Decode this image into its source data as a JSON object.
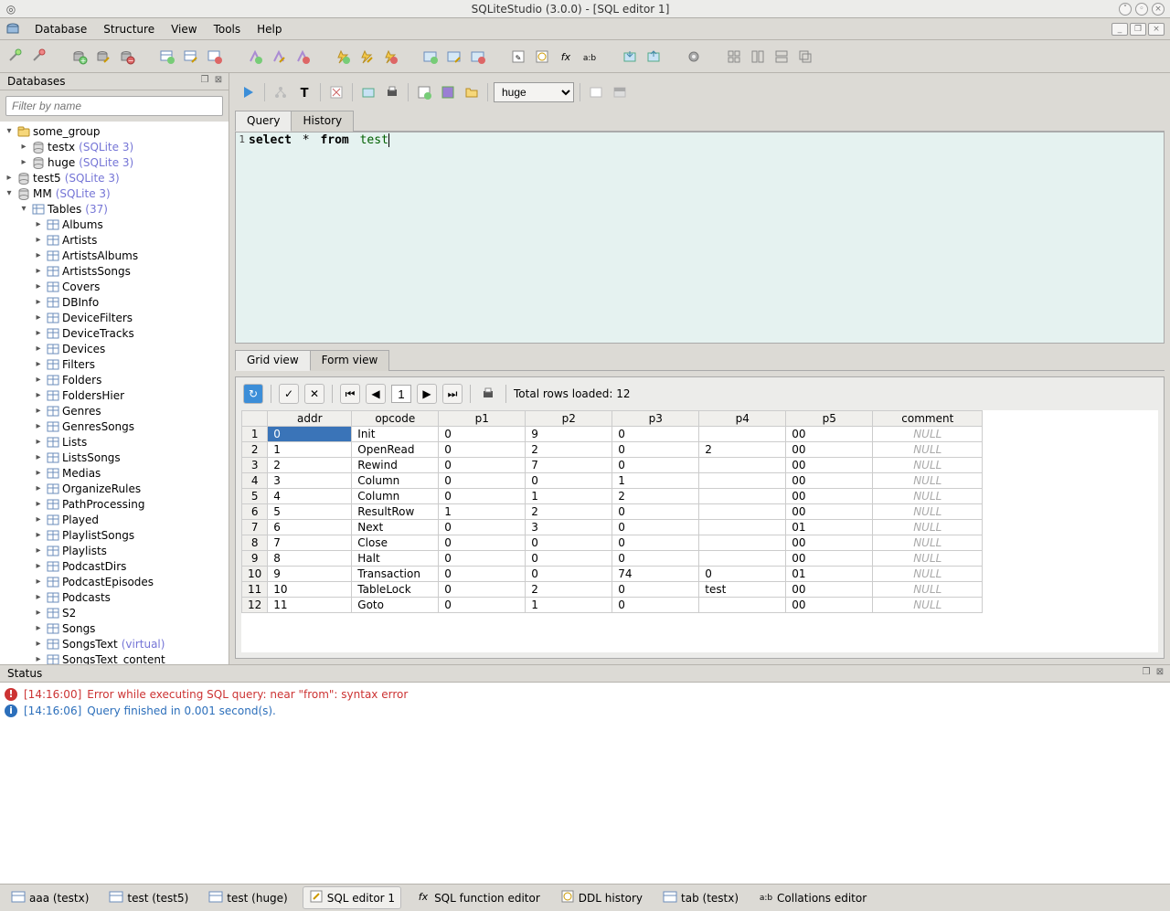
{
  "window": {
    "title": "SQLiteStudio (3.0.0) - [SQL editor 1]"
  },
  "menubar": {
    "items": [
      "Database",
      "Structure",
      "View",
      "Tools",
      "Help"
    ]
  },
  "sidebar": {
    "title": "Databases",
    "filter_placeholder": "Filter by name",
    "tree": [
      {
        "level": 0,
        "arrow": "down",
        "icon": "folder",
        "label": "some_group"
      },
      {
        "level": 1,
        "arrow": "right",
        "icon": "db",
        "label": "testx",
        "anno": "(SQLite 3)"
      },
      {
        "level": 1,
        "arrow": "right",
        "icon": "db",
        "label": "huge",
        "anno": "(SQLite 3)"
      },
      {
        "level": 0,
        "arrow": "right",
        "icon": "db",
        "label": "test5",
        "anno": "(SQLite 3)"
      },
      {
        "level": 0,
        "arrow": "down",
        "icon": "db",
        "label": "MM",
        "anno": "(SQLite 3)"
      },
      {
        "level": 1,
        "arrow": "down",
        "icon": "tables",
        "label": "Tables",
        "anno": "(37)"
      },
      {
        "level": 2,
        "arrow": "right",
        "icon": "table",
        "label": "Albums"
      },
      {
        "level": 2,
        "arrow": "right",
        "icon": "table",
        "label": "Artists"
      },
      {
        "level": 2,
        "arrow": "right",
        "icon": "table",
        "label": "ArtistsAlbums"
      },
      {
        "level": 2,
        "arrow": "right",
        "icon": "table",
        "label": "ArtistsSongs"
      },
      {
        "level": 2,
        "arrow": "right",
        "icon": "table",
        "label": "Covers"
      },
      {
        "level": 2,
        "arrow": "right",
        "icon": "table",
        "label": "DBInfo"
      },
      {
        "level": 2,
        "arrow": "right",
        "icon": "table",
        "label": "DeviceFilters"
      },
      {
        "level": 2,
        "arrow": "right",
        "icon": "table",
        "label": "DeviceTracks"
      },
      {
        "level": 2,
        "arrow": "right",
        "icon": "table",
        "label": "Devices"
      },
      {
        "level": 2,
        "arrow": "right",
        "icon": "table",
        "label": "Filters"
      },
      {
        "level": 2,
        "arrow": "right",
        "icon": "table",
        "label": "Folders"
      },
      {
        "level": 2,
        "arrow": "right",
        "icon": "table",
        "label": "FoldersHier"
      },
      {
        "level": 2,
        "arrow": "right",
        "icon": "table",
        "label": "Genres"
      },
      {
        "level": 2,
        "arrow": "right",
        "icon": "table",
        "label": "GenresSongs"
      },
      {
        "level": 2,
        "arrow": "right",
        "icon": "table",
        "label": "Lists"
      },
      {
        "level": 2,
        "arrow": "right",
        "icon": "table",
        "label": "ListsSongs"
      },
      {
        "level": 2,
        "arrow": "right",
        "icon": "table",
        "label": "Medias"
      },
      {
        "level": 2,
        "arrow": "right",
        "icon": "table",
        "label": "OrganizeRules"
      },
      {
        "level": 2,
        "arrow": "right",
        "icon": "table",
        "label": "PathProcessing"
      },
      {
        "level": 2,
        "arrow": "right",
        "icon": "table",
        "label": "Played"
      },
      {
        "level": 2,
        "arrow": "right",
        "icon": "table",
        "label": "PlaylistSongs"
      },
      {
        "level": 2,
        "arrow": "right",
        "icon": "table",
        "label": "Playlists"
      },
      {
        "level": 2,
        "arrow": "right",
        "icon": "table",
        "label": "PodcastDirs"
      },
      {
        "level": 2,
        "arrow": "right",
        "icon": "table",
        "label": "PodcastEpisodes"
      },
      {
        "level": 2,
        "arrow": "right",
        "icon": "table",
        "label": "Podcasts"
      },
      {
        "level": 2,
        "arrow": "right",
        "icon": "table",
        "label": "S2"
      },
      {
        "level": 2,
        "arrow": "right",
        "icon": "table",
        "label": "Songs"
      },
      {
        "level": 2,
        "arrow": "right",
        "icon": "table",
        "label": "SongsText",
        "anno": "(virtual)"
      },
      {
        "level": 2,
        "arrow": "right",
        "icon": "table",
        "label": "SongsText_content"
      }
    ]
  },
  "editor": {
    "db_select": "huge",
    "tabs": {
      "query": "Query",
      "history": "History"
    },
    "query": {
      "line_no": "1",
      "kw1": "select",
      "star": "*",
      "kw2": "from",
      "ident": "test"
    },
    "result_tabs": {
      "grid": "Grid view",
      "form": "Form view"
    },
    "pager": {
      "value": "1"
    },
    "status_text": "Total rows loaded: 12",
    "columns": [
      "addr",
      "opcode",
      "p1",
      "p2",
      "p3",
      "p4",
      "p5",
      "comment"
    ],
    "rows": [
      {
        "n": "1",
        "addr": "0",
        "opcode": "Init",
        "p1": "0",
        "p2": "9",
        "p3": "0",
        "p4": "",
        "p5": "00",
        "comment": null,
        "sel": true
      },
      {
        "n": "2",
        "addr": "1",
        "opcode": "OpenRead",
        "p1": "0",
        "p2": "2",
        "p3": "0",
        "p4": "2",
        "p5": "00",
        "comment": null
      },
      {
        "n": "3",
        "addr": "2",
        "opcode": "Rewind",
        "p1": "0",
        "p2": "7",
        "p3": "0",
        "p4": "",
        "p5": "00",
        "comment": null
      },
      {
        "n": "4",
        "addr": "3",
        "opcode": "Column",
        "p1": "0",
        "p2": "0",
        "p3": "1",
        "p4": "",
        "p5": "00",
        "comment": null
      },
      {
        "n": "5",
        "addr": "4",
        "opcode": "Column",
        "p1": "0",
        "p2": "1",
        "p3": "2",
        "p4": "",
        "p5": "00",
        "comment": null
      },
      {
        "n": "6",
        "addr": "5",
        "opcode": "ResultRow",
        "p1": "1",
        "p2": "2",
        "p3": "0",
        "p4": "",
        "p5": "00",
        "comment": null
      },
      {
        "n": "7",
        "addr": "6",
        "opcode": "Next",
        "p1": "0",
        "p2": "3",
        "p3": "0",
        "p4": "",
        "p5": "01",
        "comment": null
      },
      {
        "n": "8",
        "addr": "7",
        "opcode": "Close",
        "p1": "0",
        "p2": "0",
        "p3": "0",
        "p4": "",
        "p5": "00",
        "comment": null
      },
      {
        "n": "9",
        "addr": "8",
        "opcode": "Halt",
        "p1": "0",
        "p2": "0",
        "p3": "0",
        "p4": "",
        "p5": "00",
        "comment": null
      },
      {
        "n": "10",
        "addr": "9",
        "opcode": "Transaction",
        "p1": "0",
        "p2": "0",
        "p3": "74",
        "p4": "0",
        "p5": "01",
        "comment": null
      },
      {
        "n": "11",
        "addr": "10",
        "opcode": "TableLock",
        "p1": "0",
        "p2": "2",
        "p3": "0",
        "p4": "test",
        "p5": "00",
        "comment": null
      },
      {
        "n": "12",
        "addr": "11",
        "opcode": "Goto",
        "p1": "0",
        "p2": "1",
        "p3": "0",
        "p4": "",
        "p5": "00",
        "comment": null
      }
    ]
  },
  "status": {
    "title": "Status",
    "lines": [
      {
        "type": "error",
        "ts": "[14:16:00]",
        "msg": "Error while executing SQL query: near \"from\": syntax error"
      },
      {
        "type": "info",
        "ts": "[14:16:06]",
        "msg": "Query finished in 0.001 second(s)."
      }
    ]
  },
  "bottom_tabs": [
    {
      "icon": "table",
      "label": "aaa (testx)"
    },
    {
      "icon": "table",
      "label": "test (test5)"
    },
    {
      "icon": "table",
      "label": "test (huge)"
    },
    {
      "icon": "editor",
      "label": "SQL editor 1",
      "active": true
    },
    {
      "icon": "fx",
      "label": "SQL function editor"
    },
    {
      "icon": "history",
      "label": "DDL history"
    },
    {
      "icon": "table",
      "label": "tab (testx)"
    },
    {
      "icon": "collation",
      "label": "Collations editor"
    }
  ]
}
